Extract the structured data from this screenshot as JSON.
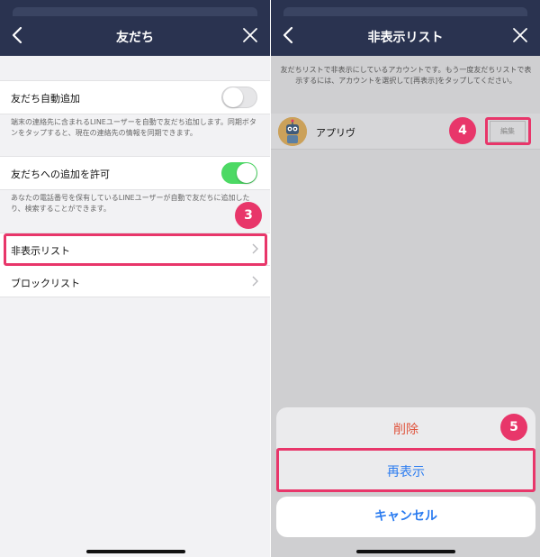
{
  "left": {
    "header": {
      "title": "友だち",
      "back_icon": "chevron-left-icon",
      "close_icon": "close-icon"
    },
    "auto_add": {
      "label": "友だち自動追加",
      "toggle": "off",
      "description": "端末の連絡先に含まれるLINEユーザーを自動で友だち追加します。同期ボタンをタップすると、現在の連絡先の情報を同期できます。"
    },
    "allow_add": {
      "label": "友だちへの追加を許可",
      "toggle": "on",
      "description": "あなたの電話番号を保有しているLINEユーザーが自動で友だちに追加したり、検索することができます。"
    },
    "menu": [
      {
        "label": "非表示リスト"
      },
      {
        "label": "ブロックリスト"
      }
    ],
    "step_badge": "3"
  },
  "right": {
    "header": {
      "title": "非表示リスト",
      "back_icon": "chevron-left-icon",
      "close_icon": "close-icon"
    },
    "info": "友だちリストで非表示にしているアカウントです。もう一度友だちリストで表示するには、アカウントを選択して[再表示]をタップしてください。",
    "friend": {
      "name": "アプリヴ",
      "avatar_icon": "robot-avatar-icon",
      "edit_label": "編集"
    },
    "step_edit": "4",
    "sheet": {
      "delete": "削除",
      "redisplay": "再表示",
      "cancel": "キャンセル"
    },
    "step_sheet": "5"
  },
  "colors": {
    "header_bg": "#2a3350",
    "highlight": "#e8366a",
    "toggle_on": "#4cd964",
    "destructive": "#e0533c",
    "action_blue": "#2a7bf0"
  }
}
